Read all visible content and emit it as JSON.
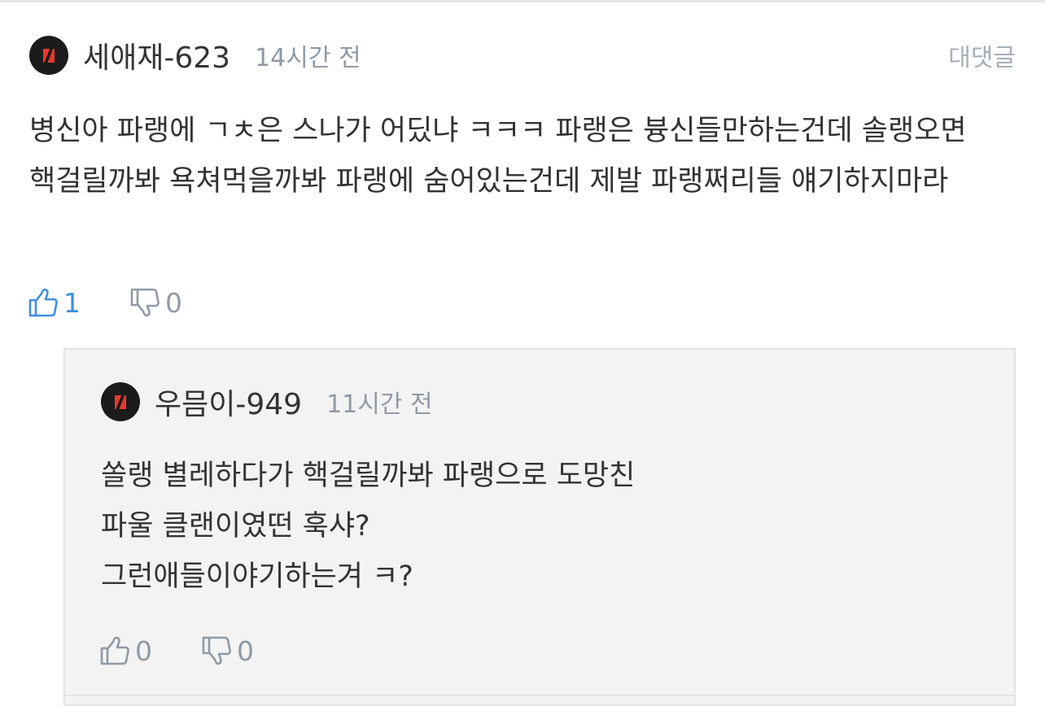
{
  "comment": {
    "username": "세애재-623",
    "time": "14시간 전",
    "reply_label": "대댓글",
    "body": "병신아 파랭에 ㄱㅊ은 스나가 어딨냐 ㅋㅋㅋ 파랭은 븅신들만하는건데 솔랭오면 핵걸릴까봐 욕쳐먹을까봐 파랭에 숨어있는건데 제발 파랭쩌리들 얘기하지마라",
    "likes": "1",
    "dislikes": "0"
  },
  "reply": {
    "username": "우믐이-949",
    "time": "11시간 전",
    "body": "쏠랭 별레하다가 핵걸릴까봐 파랭으로 도망친\n 파울 클랜이였떤 훅샤?\n그런애들이야기하는겨 ㅋ?",
    "likes": "0",
    "dislikes": "0"
  },
  "colors": {
    "avatar_bg": "#1b1b1b",
    "avatar_logo": "#e8382f",
    "like_active": "#3f8ee6",
    "muted": "#8f9aa7",
    "reply_bg": "#f3f3f3"
  },
  "icons": {
    "avatar": "slash-logo-avatar",
    "like": "thumbs-up-icon",
    "dislike": "thumbs-down-icon"
  }
}
